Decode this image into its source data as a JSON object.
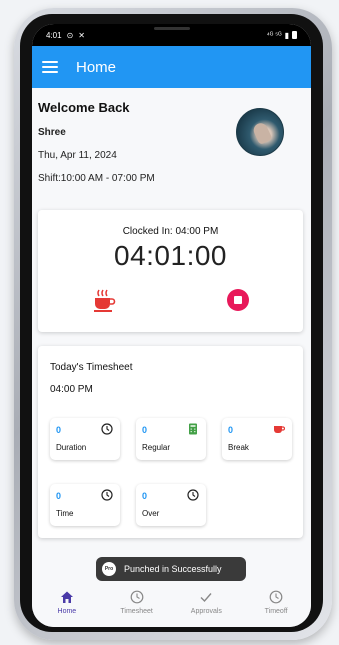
{
  "status_bar": {
    "time": "4:01",
    "right_text": "⁴ᴳ"
  },
  "app_bar": {
    "title": "Home"
  },
  "welcome": {
    "title": "Welcome Back",
    "name": "Shree",
    "date": "Thu, Apr 11, 2024",
    "shift": "Shift:10:00 AM - 07:00 PM"
  },
  "clock": {
    "clocked_in_label": "Clocked In: 04:00 PM",
    "elapsed": "04:01:00"
  },
  "timesheet": {
    "title": "Today's Timesheet",
    "start_time": "04:00 PM",
    "tiles": [
      {
        "value": "0",
        "label": "Duration",
        "icon": "clock-icon"
      },
      {
        "value": "0",
        "label": "Regular",
        "icon": "calculator-icon"
      },
      {
        "value": "0",
        "label": "Break",
        "icon": "coffee-icon"
      },
      {
        "value": "0",
        "label": "Time",
        "icon": "clock-icon"
      },
      {
        "value": "0",
        "label": "Over",
        "icon": "clock-icon"
      }
    ]
  },
  "toast": {
    "logo_text": "Pro",
    "message": "Punched in Successfully"
  },
  "bottom_nav": {
    "items": [
      {
        "label": "Home",
        "icon": "home-icon",
        "active": true
      },
      {
        "label": "Timesheet",
        "icon": "clock-icon",
        "active": false
      },
      {
        "label": "Approvals",
        "icon": "check-icon",
        "active": false
      },
      {
        "label": "Timeoff",
        "icon": "clock-icon",
        "active": false
      }
    ]
  },
  "colors": {
    "primary": "#2196f3",
    "accent_red": "#e8195a",
    "break_red": "#e53935",
    "regular_green": "#43a047",
    "nav_active": "#4a3aa8"
  }
}
